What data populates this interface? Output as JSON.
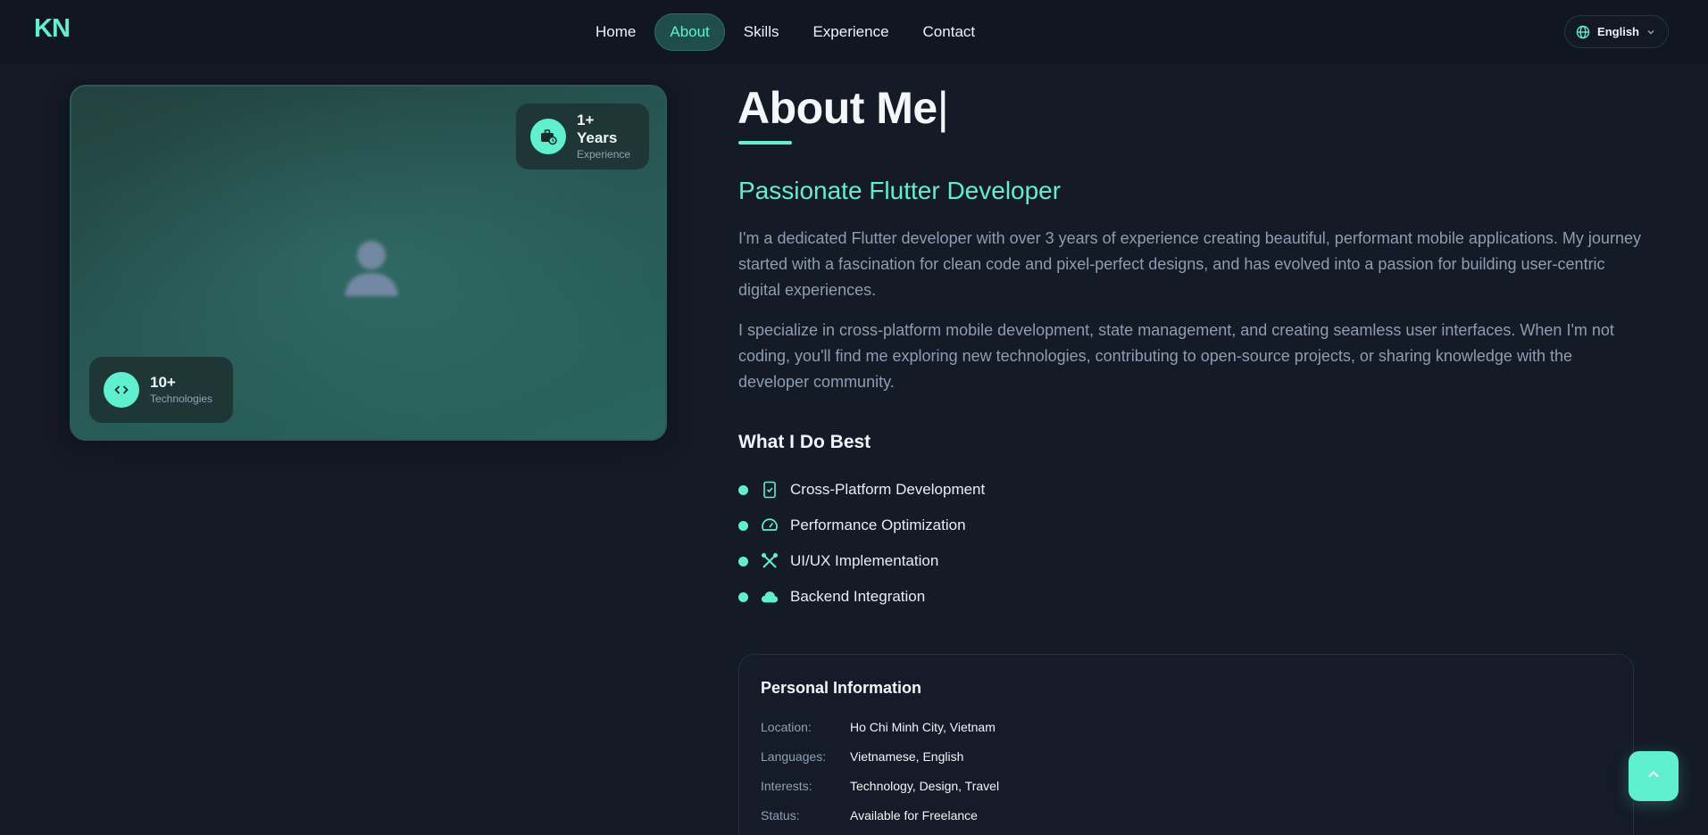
{
  "nav": {
    "logo": "KN",
    "items": [
      {
        "label": "Home"
      },
      {
        "label": "About"
      },
      {
        "label": "Skills"
      },
      {
        "label": "Experience"
      },
      {
        "label": "Contact"
      }
    ],
    "active": "About",
    "language": "English"
  },
  "image_card": {
    "years": {
      "value": "1+ Years",
      "label": "Experience",
      "icon": "briefcase-clock-icon"
    },
    "technologies": {
      "value": "10+",
      "label": "Technologies",
      "icon": "code-icon"
    }
  },
  "about": {
    "title": "About Me",
    "caret": "|",
    "subtitle": "Passionate Flutter Developer",
    "paragraph_1": "I'm a dedicated Flutter developer with over 3 years of experience creating beautiful, performant mobile applications. My journey started with a fascination for clean code and pixel-perfect designs, and has evolved into a passion for building user-centric digital experiences.",
    "paragraph_2": "I specialize in cross-platform mobile development, state management, and creating seamless user interfaces. When I'm not coding, you'll find me exploring new technologies, contributing to open-source projects, or sharing knowledge with the developer community."
  },
  "best": {
    "title": "What I Do Best",
    "items": [
      {
        "label": "Cross-Platform Development",
        "icon": "mobile-check-icon"
      },
      {
        "label": "Performance Optimization",
        "icon": "speedometer-icon"
      },
      {
        "label": "UI/UX Implementation",
        "icon": "design-tools-icon"
      },
      {
        "label": "Backend Integration",
        "icon": "cloud-icon"
      }
    ]
  },
  "personal_info": {
    "title": "Personal Information",
    "rows": [
      {
        "label": "Location:",
        "value": "Ho Chi Minh City, Vietnam"
      },
      {
        "label": "Languages:",
        "value": "Vietnamese, English"
      },
      {
        "label": "Interests:",
        "value": "Technology, Design, Travel"
      },
      {
        "label": "Status:",
        "value": "Available for Freelance"
      }
    ]
  },
  "colors": {
    "accent": "#5ff0cf",
    "background": "#141a26",
    "text_muted": "#8e9db1"
  }
}
